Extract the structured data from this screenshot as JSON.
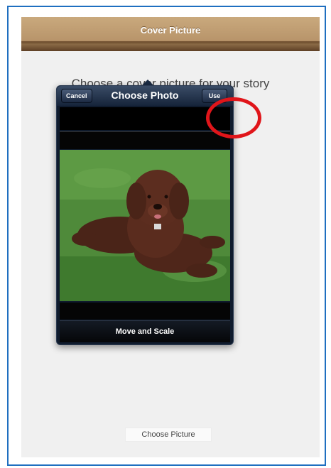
{
  "header": {
    "title": "Cover Picture"
  },
  "prompt": "Choose a cover picture for your story",
  "popover": {
    "title": "Choose Photo",
    "cancel_label": "Cancel",
    "use_label": "Use",
    "footer_label": "Move and Scale"
  },
  "bottom": {
    "choose_picture_label": "Choose Picture"
  },
  "colors": {
    "highlight_circle": "#e0151a",
    "frame_border": "#1f6fc0",
    "popover_bg": "#0f1b2d"
  }
}
